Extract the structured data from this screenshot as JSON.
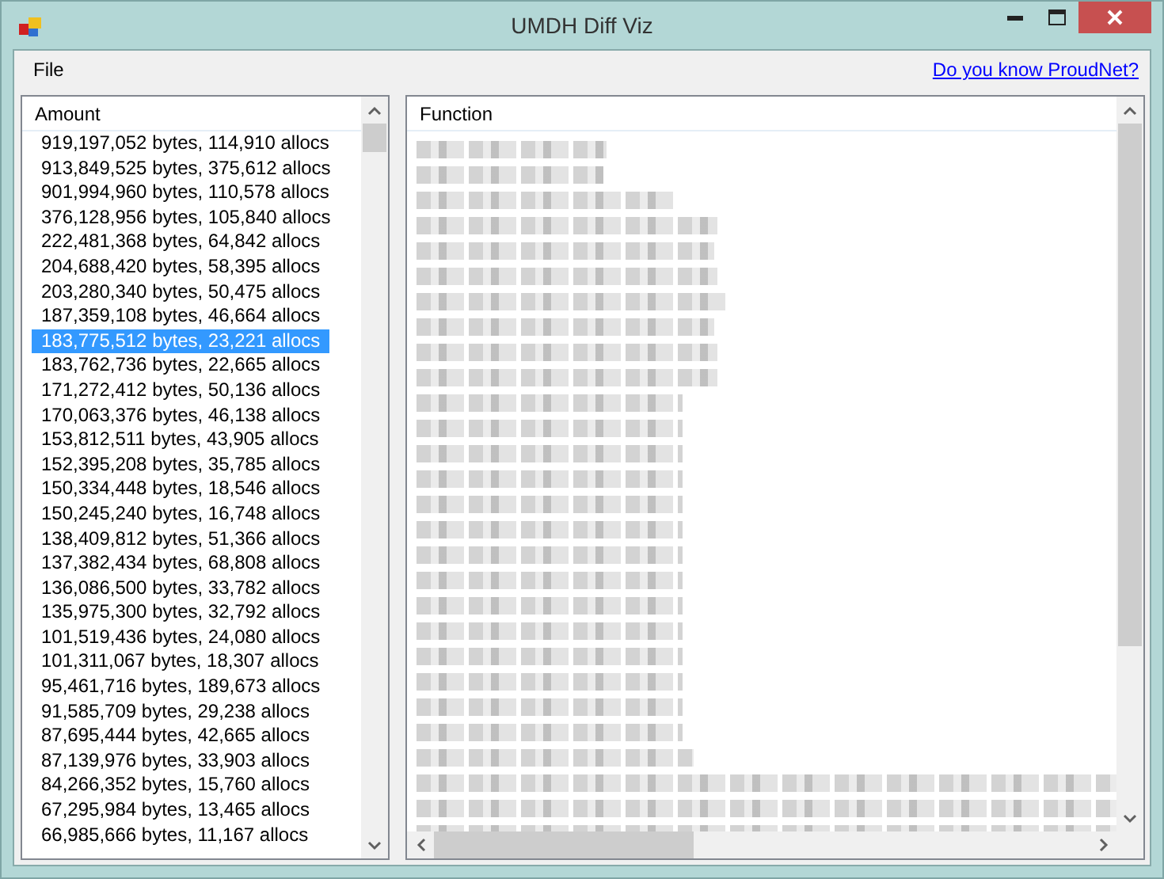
{
  "window": {
    "title": "UMDH Diff Viz"
  },
  "menu": [
    "File"
  ],
  "link": "Do you know ProudNet?",
  "amount_list": {
    "header": "Amount",
    "rows": [
      {
        "text": "919,197,052 bytes, 114,910 allocs",
        "selected": false
      },
      {
        "text": "913,849,525 bytes, 375,612 allocs",
        "selected": false
      },
      {
        "text": "901,994,960 bytes, 110,578 allocs",
        "selected": false
      },
      {
        "text": "376,128,956 bytes, 105,840 allocs",
        "selected": false
      },
      {
        "text": "222,481,368 bytes, 64,842 allocs",
        "selected": false
      },
      {
        "text": "204,688,420 bytes, 58,395 allocs",
        "selected": false
      },
      {
        "text": "203,280,340 bytes, 50,475 allocs",
        "selected": false
      },
      {
        "text": "187,359,108 bytes, 46,664 allocs",
        "selected": false
      },
      {
        "text": "183,775,512 bytes, 23,221 allocs",
        "selected": true
      },
      {
        "text": "183,762,736 bytes, 22,665 allocs",
        "selected": false
      },
      {
        "text": "171,272,412 bytes, 50,136 allocs",
        "selected": false
      },
      {
        "text": "170,063,376 bytes, 46,138 allocs",
        "selected": false
      },
      {
        "text": "153,812,511 bytes, 43,905 allocs",
        "selected": false
      },
      {
        "text": "152,395,208 bytes, 35,785 allocs",
        "selected": false
      },
      {
        "text": "150,334,448 bytes, 18,546 allocs",
        "selected": false
      },
      {
        "text": "150,245,240 bytes, 16,748 allocs",
        "selected": false
      },
      {
        "text": "138,409,812 bytes, 51,366 allocs",
        "selected": false
      },
      {
        "text": "137,382,434 bytes, 68,808 allocs",
        "selected": false
      },
      {
        "text": "136,086,500 bytes, 33,782 allocs",
        "selected": false
      },
      {
        "text": "135,975,300 bytes, 32,792 allocs",
        "selected": false
      },
      {
        "text": "101,519,436 bytes, 24,080 allocs",
        "selected": false
      },
      {
        "text": "101,311,067 bytes, 18,307 allocs",
        "selected": false
      },
      {
        "text": "95,461,716 bytes, 189,673 allocs",
        "selected": false
      },
      {
        "text": "91,585,709 bytes, 29,238 allocs",
        "selected": false
      },
      {
        "text": "87,695,444 bytes, 42,665 allocs",
        "selected": false
      },
      {
        "text": "87,139,976 bytes, 33,903 allocs",
        "selected": false
      },
      {
        "text": "84,266,352 bytes, 15,760 allocs",
        "selected": false
      },
      {
        "text": "67,295,984 bytes, 13,465 allocs",
        "selected": false
      },
      {
        "text": "66,985,666 bytes, 11,167 allocs",
        "selected": false
      }
    ]
  },
  "function_list": {
    "header": "Function"
  }
}
